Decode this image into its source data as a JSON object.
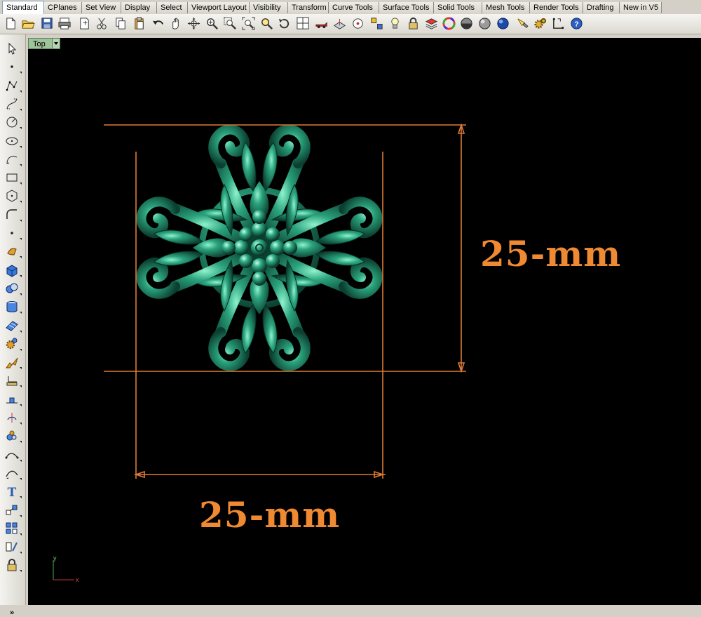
{
  "tabs": [
    {
      "label": "Standard",
      "active": true
    },
    {
      "label": "CPlanes"
    },
    {
      "label": "Set View"
    },
    {
      "label": "Display"
    },
    {
      "label": "Select"
    },
    {
      "label": "Viewport Layout"
    },
    {
      "label": "Visibility"
    },
    {
      "label": "Transform"
    },
    {
      "label": "Curve Tools"
    },
    {
      "label": "Surface Tools"
    },
    {
      "label": "Solid Tools"
    },
    {
      "label": "Mesh Tools"
    },
    {
      "label": "Render Tools"
    },
    {
      "label": "Drafting"
    },
    {
      "label": "New in V5"
    }
  ],
  "toolbar": {
    "icons": [
      "new-document-icon",
      "open-folder-icon",
      "save-icon",
      "print-icon",
      "import-icon",
      "cut-icon",
      "copy-icon",
      "paste-icon",
      "undo-icon",
      "pan-hand-icon",
      "rotate-view-icon",
      "zoom-dynamic-icon",
      "zoom-window-icon",
      "zoom-extents-icon",
      "zoom-selected-icon",
      "undo-view-icon",
      "four-viewports-icon",
      "named-view-camera-icon",
      "cplane-icon",
      "snap-circle-icon",
      "point-filter-icon",
      "light-bulb-icon",
      "lock-icon",
      "layer-icon",
      "color-wheel-icon",
      "shade-icon",
      "rendered-sphere-icon",
      "render-sphere-icon",
      "flashlight-icon",
      "options-gear-icon",
      "grid-snap-icon",
      "help-icon"
    ]
  },
  "left_toolbar": {
    "icons": [
      "select-arrow-icon",
      "point-icon",
      "polyline-icon",
      "curve-icon",
      "circle-icon",
      "ellipse-icon",
      "arc-icon",
      "rectangle-icon",
      "polygon-icon",
      "curve-fillet-icon",
      "surface-points-icon",
      "extrude-surface-icon",
      "box-solid-icon",
      "solid-union-icon",
      "cylinder-tube-icon",
      "mesh-plane-icon",
      "transform-gear-icon",
      "explode-icon",
      "dimension-icon",
      "leader-icon",
      "split-icon",
      "boolean-icon",
      "rebuild-curve-icon",
      "curve-from-object-icon",
      "text-icon",
      "move-icon",
      "array-icon",
      "analyze-icon",
      "block-box-icon"
    ],
    "more_label": "»"
  },
  "viewport": {
    "name": "Top",
    "background": "#000000",
    "ornament_color": "#1f8a6b",
    "dimension_color": "#f08a32",
    "dim_height_label": "25-mm",
    "dim_width_label": "25-mm",
    "axis_x_label": "x",
    "axis_y_label": "y"
  }
}
